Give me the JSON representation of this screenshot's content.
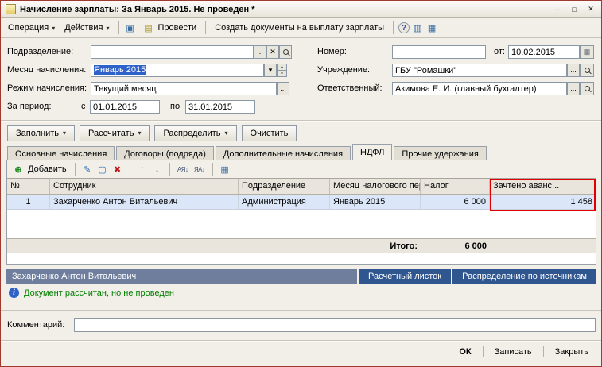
{
  "window": {
    "title": "Начисление зарплаты: За Январь 2015. Не проведен *"
  },
  "toolbar": {
    "operation": "Операция",
    "actions": "Действия",
    "post": "Провести",
    "create_payout_docs": "Создать документы на выплату зарплаты"
  },
  "form": {
    "department": {
      "label": "Подразделение:",
      "value": ""
    },
    "accrual_month": {
      "label": "Месяц начисления:",
      "value": "Январь 2015"
    },
    "accrual_mode": {
      "label": "Режим начисления:",
      "value": "Текущий месяц"
    },
    "period": {
      "label": "За период:",
      "from_label": "с",
      "from": "01.01.2015",
      "to_label": "по",
      "to": "31.01.2015"
    },
    "number": {
      "label": "Номер:",
      "value": "",
      "date_label": "от:",
      "date": "10.02.2015"
    },
    "institution": {
      "label": "Учреждение:",
      "value": "ГБУ \"Ромашки\""
    },
    "responsible": {
      "label": "Ответственный:",
      "value": "Акимова Е. И. (главный бухгалтер)"
    }
  },
  "action_buttons": {
    "fill": "Заполнить",
    "calculate": "Рассчитать",
    "distribute": "Распределить",
    "clear": "Очистить"
  },
  "tabs": [
    {
      "label": "Основные начисления"
    },
    {
      "label": "Договоры (подряда)"
    },
    {
      "label": "Дополнительные начисления"
    },
    {
      "label": "НДФЛ"
    },
    {
      "label": "Прочие удержания"
    }
  ],
  "table": {
    "add_label": "Добавить",
    "headers": [
      "№",
      "Сотрудник",
      "Подразделение",
      "Месяц налогового пери...",
      "Налог",
      "Зачтено аванс..."
    ],
    "rows": [
      {
        "num": "1",
        "employee": "Захарченко Антон Витальевич",
        "department": "Администрация",
        "tax_month": "Январь 2015",
        "tax": "6 000",
        "advance_credited": "1 458"
      }
    ],
    "total_label": "Итого:",
    "total_tax": "6 000"
  },
  "footer": {
    "current_employee": "Захарченко Антон Витальевич",
    "payslip_link": "Расчетный листок",
    "sources_link": "Распределение по источникам",
    "status": "Документ рассчитан, но не проведен",
    "comment_label": "Комментарий:",
    "comment_value": ""
  },
  "bottom": {
    "ok": "ОК",
    "save": "Записать",
    "close": "Закрыть"
  },
  "icons": {
    "minimize": "─",
    "maximize": "□",
    "close": "✕",
    "dropdown": "▾",
    "spin_up": "▴",
    "spin_down": "▾",
    "save": "▣",
    "post": "▤",
    "structure": "▥",
    "movements": "▦",
    "help": "?",
    "calendar": "▦",
    "ellipsis": "...",
    "clear_x": "✕",
    "add": "⊕",
    "edit": "✎",
    "copy": "▢",
    "delete": "✖",
    "up": "↑",
    "down": "↓",
    "sort_asc": "АЯ↓",
    "sort_desc": "ЯА↓",
    "grid": "▦",
    "info": "i"
  },
  "colors": {
    "annotation_border": "#e00000",
    "status_text": "#008000",
    "selection": "#2f62c9",
    "employee_bar": "#6e7e9c",
    "link_block": "#30568f"
  }
}
